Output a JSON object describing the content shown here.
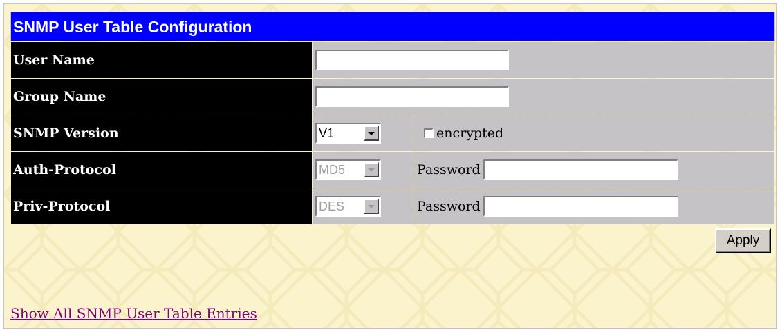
{
  "title": "SNMP User Table Configuration",
  "rows": [
    {
      "label": "User Name",
      "value": ""
    },
    {
      "label": "Group Name",
      "value": ""
    },
    {
      "label": "SNMP Version",
      "selected": "V1",
      "checkbox_label": "encrypted",
      "checked": false
    },
    {
      "label": "Auth-Protocol",
      "selected": "MD5",
      "password_label": "Password",
      "password_value": ""
    },
    {
      "label": "Priv-Protocol",
      "selected": "DES",
      "password_label": "Password",
      "password_value": ""
    }
  ],
  "apply_label": "Apply",
  "link_text": "Show All SNMP User Table Entries",
  "colors": {
    "title_bg": "#0000ff",
    "label_bg": "#000000",
    "value_bg": "#c6c3c6",
    "page_bg": "#fbf3cc",
    "link": "#800080"
  }
}
